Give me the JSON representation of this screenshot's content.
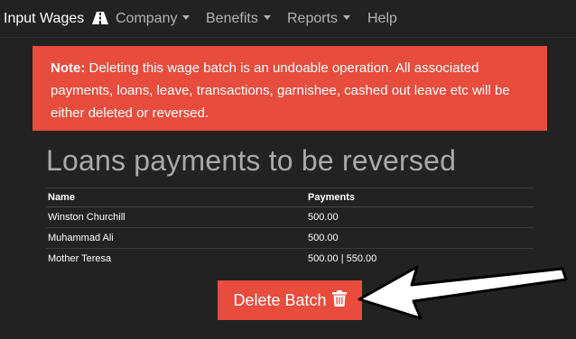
{
  "navbar": {
    "brand": "Input Wages",
    "brand_icon": "road-icon",
    "items": [
      {
        "label": "Company",
        "dropdown": true
      },
      {
        "label": "Benefits",
        "dropdown": true
      },
      {
        "label": "Reports",
        "dropdown": true
      },
      {
        "label": "Help",
        "dropdown": false
      }
    ]
  },
  "alert": {
    "label": "Note:",
    "text": " Deleting this wage batch is an undoable operation. All associated payments, loans, leave, transactions, garnishee, cashed out leave etc will be either deleted or reversed.",
    "color": "#e74c3c"
  },
  "section": {
    "title": "Loans payments to be reversed"
  },
  "table": {
    "headers": [
      "Name",
      "Payments"
    ],
    "rows": [
      {
        "name": "Winston Churchill",
        "payments": "500.00"
      },
      {
        "name": "Muhammad Ali",
        "payments": "500.00"
      },
      {
        "name": "Mother Teresa",
        "payments": "500.00 | 550.00"
      }
    ]
  },
  "actions": {
    "delete_label": "Delete Batch",
    "delete_icon": "trash-icon",
    "delete_color": "#e74c3c"
  }
}
